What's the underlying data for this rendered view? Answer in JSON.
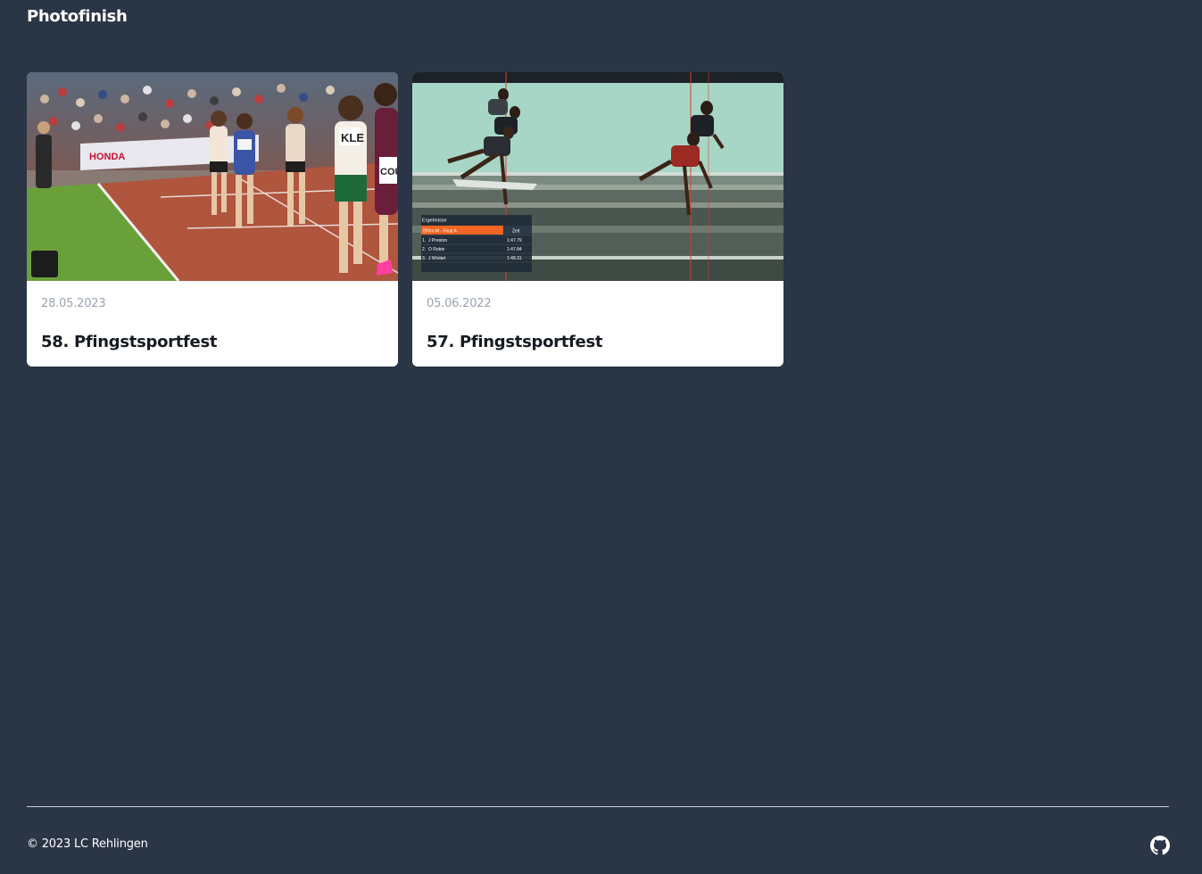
{
  "header": {
    "title": "Photofinish"
  },
  "events": [
    {
      "date": "28.05.2023",
      "title": "58. Pfingstsportfest",
      "image": "race-finish-photo"
    },
    {
      "date": "05.06.2022",
      "title": "57. Pfingstsportfest",
      "image": "photofinish-camera-image",
      "results_overlay": {
        "heading": "Ergebnisse",
        "race": "800m M - Final A",
        "time_header": "Zeit",
        "rows": [
          {
            "rank": "1.",
            "name": "J  Preston",
            "time": "1:47.79"
          },
          {
            "rank": "2.",
            "name": "O  Robin",
            "time": "1:47.84"
          },
          {
            "rank": "3.",
            "name": "J  Wiolart",
            "time": "1:48.31"
          }
        ]
      }
    }
  ],
  "footer": {
    "copyright": "© 2023 LC Rehlingen",
    "github_icon": "github-icon"
  },
  "colors": {
    "background": "#2a3546",
    "card": "#ffffff",
    "date_text": "#9aa3ae",
    "results_accent": "#f26522"
  }
}
